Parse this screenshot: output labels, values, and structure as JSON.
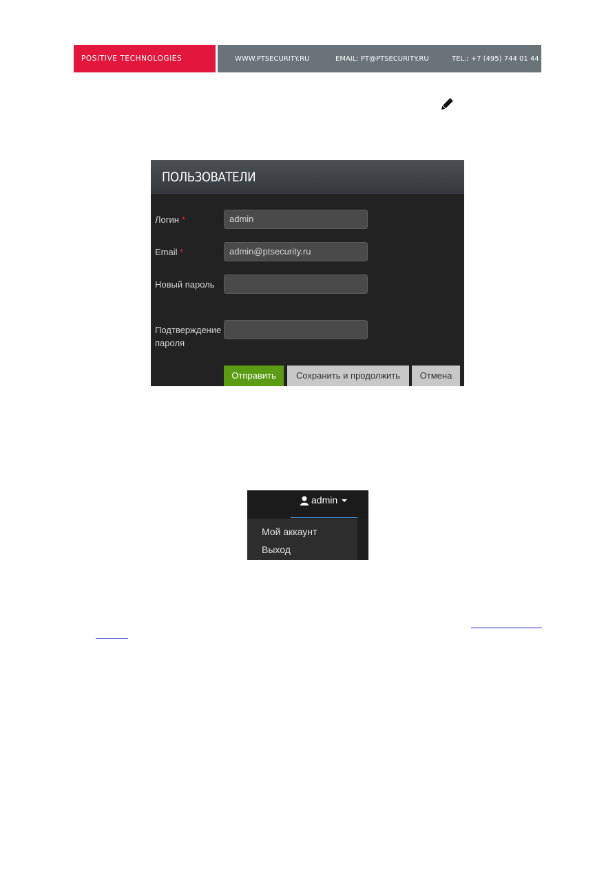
{
  "banner": {
    "brand": "POSITIVE TECHNOLOGIES",
    "website": "WWW.PTSECURITY.RU",
    "email": "EMAIL: PT@PTSECURITY.RU",
    "phone": "TEL.: +7 (495) 744 01 44",
    "brand_color": "#e3173e",
    "info_color": "#6a727a"
  },
  "inline_icon": "pencil-icon",
  "users_form": {
    "title": "ПОЛЬЗОВАТЕЛИ",
    "login_label": "Логин",
    "login_value": "admin",
    "email_label": "Email",
    "email_value": "admin@ptsecurity.ru",
    "required_mark": "*",
    "new_password_label": "Новый пароль",
    "new_password_value": "",
    "confirm_label_line1": "Подтверждение",
    "confirm_label_line2": "пароля",
    "confirm_value": "",
    "submit_label": "Отправить",
    "save_continue_label": "Сохранить и продолжить",
    "cancel_label": "Отмена",
    "submit_color": "#5c9c14"
  },
  "user_menu": {
    "username": "admin",
    "user_icon": "user-icon",
    "items": [
      "Мой аккаунт",
      "Выход"
    ],
    "active_underline_color": "#3b8fd9"
  }
}
